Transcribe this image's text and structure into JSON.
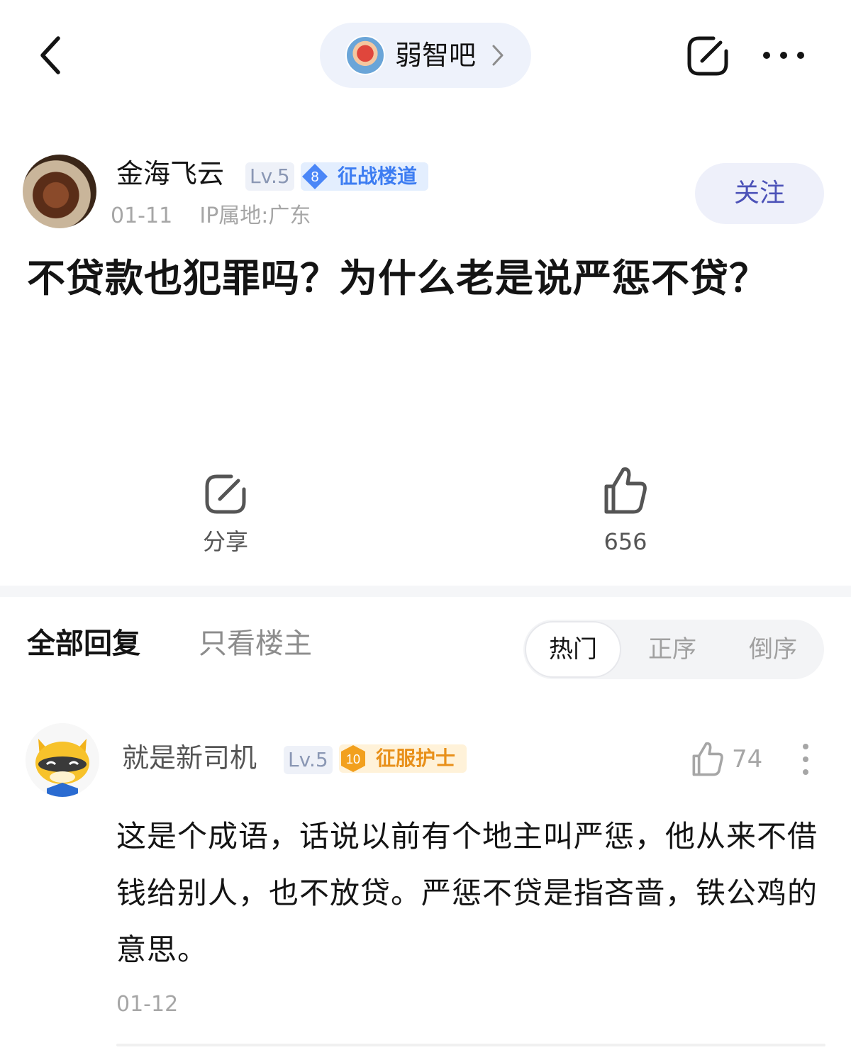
{
  "header": {
    "forum_name": "弱智吧",
    "icons": {
      "back": "chevron-left-icon",
      "share": "share-icon",
      "more": "more-dots-icon"
    }
  },
  "post": {
    "author": {
      "name": "金海飞云",
      "level": "Lv.5",
      "badge_number": "8",
      "badge_title": "征战楼道",
      "badge_color": "#4a86f7",
      "date": "01-11",
      "ip_location": "IP属地:广东"
    },
    "follow_label": "关注",
    "title": "不贷款也犯罪吗？为什么老是说严惩不贷？",
    "actions": {
      "share_label": "分享",
      "like_count": "656"
    }
  },
  "replies": {
    "tab_all": "全部回复",
    "tab_op_only": "只看楼主",
    "sort": {
      "hot": "热门",
      "ascending": "正序",
      "descending": "倒序"
    },
    "items": [
      {
        "user": "就是新司机",
        "level": "Lv.5",
        "badge_number": "10",
        "badge_title": "征服护士",
        "badge_color": "#f2a01e",
        "likes": "74",
        "text": "这是个成语，话说以前有个地主叫严惩，他从来不借钱给别人，也不放贷。严惩不贷是指吝啬，铁公鸡的意思。",
        "date": "01-12"
      }
    ]
  },
  "colors": {
    "accent": "#4c52b8",
    "follow_bg": "#eef0fa",
    "pill_bg": "#eef2fb"
  }
}
